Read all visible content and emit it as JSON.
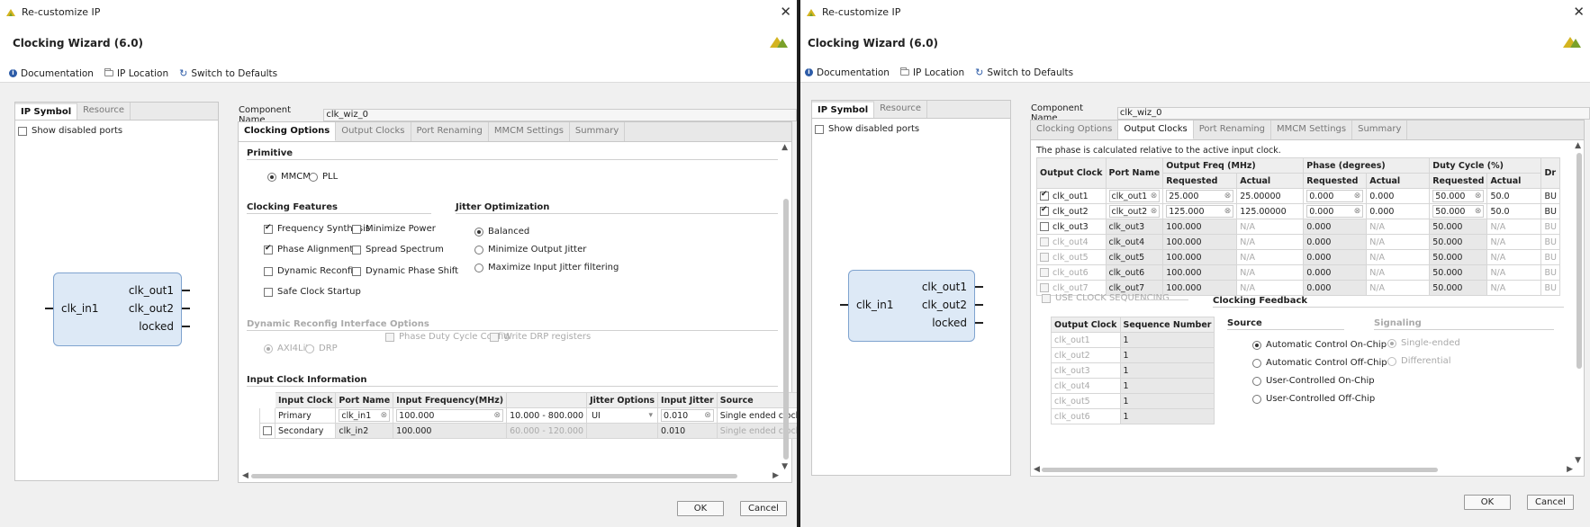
{
  "left": {
    "title_bar": "Re-customize IP",
    "wizard_title": "Clocking Wizard (6.0)",
    "links": {
      "documentation": "Documentation",
      "ip_location": "IP Location",
      "defaults": "Switch to Defaults"
    },
    "left_tabs": [
      "IP Symbol",
      "Resource"
    ],
    "show_disabled": "Show disabled ports",
    "symbol": {
      "in": "clk_in1",
      "outs": [
        "clk_out1",
        "clk_out2",
        "locked"
      ]
    },
    "component_label": "Component Name",
    "component_value": "clk_wiz_0",
    "tabs": [
      "Clocking Options",
      "Output Clocks",
      "Port Renaming",
      "MMCM Settings",
      "Summary"
    ],
    "primitive": {
      "title": "Primitive",
      "options": [
        "MMCM",
        "PLL"
      ],
      "selected": "MMCM"
    },
    "features": {
      "title": "Clocking Features",
      "items": [
        {
          "label": "Frequency Synthesis",
          "checked": true
        },
        {
          "label": "Minimize Power",
          "checked": false
        },
        {
          "label": "Phase Alignment",
          "checked": true
        },
        {
          "label": "Spread Spectrum",
          "checked": false
        },
        {
          "label": "Dynamic Reconfig",
          "checked": false
        },
        {
          "label": "Dynamic Phase Shift",
          "checked": false
        },
        {
          "label": "Safe Clock Startup",
          "checked": false
        }
      ]
    },
    "jitter": {
      "title": "Jitter Optimization",
      "options": [
        "Balanced",
        "Minimize Output Jitter",
        "Maximize Input Jitter filtering"
      ],
      "selected": "Balanced"
    },
    "dyn": {
      "title": "Dynamic Reconfig Interface Options",
      "radios": [
        "AXI4Lite",
        "DRP"
      ],
      "checks": [
        "Phase Duty Cycle Config",
        "Write DRP registers"
      ]
    },
    "input_info": {
      "title": "Input Clock Information",
      "headers": [
        "Input Clock",
        "Port Name",
        "Input Frequency(MHz)",
        "",
        "Jitter Options",
        "Input Jitter",
        "Source"
      ],
      "rows": [
        {
          "clock": "Primary",
          "port": "clk_in1",
          "freq": "100.000",
          "range": "10.000 - 800.000",
          "jitter_opt": "UI",
          "jitter": "0.010",
          "source": "Single ended clock capable p"
        },
        {
          "clock": "Secondary",
          "port": "clk_in2",
          "freq": "100.000",
          "range": "60.000 - 120.000",
          "jitter_opt": "",
          "jitter": "0.010",
          "source": "Single ended clock capable p"
        }
      ]
    },
    "ok": "OK",
    "cancel": "Cancel"
  },
  "right": {
    "title_bar": "Re-customize IP",
    "wizard_title": "Clocking Wizard (6.0)",
    "links": {
      "documentation": "Documentation",
      "ip_location": "IP Location",
      "defaults": "Switch to Defaults"
    },
    "left_tabs": [
      "IP Symbol",
      "Resource"
    ],
    "show_disabled": "Show disabled ports",
    "symbol": {
      "in": "clk_in1",
      "outs": [
        "clk_out1",
        "clk_out2",
        "locked"
      ]
    },
    "component_label": "Component Name",
    "component_value": "clk_wiz_0",
    "tabs": [
      "Clocking Options",
      "Output Clocks",
      "Port Renaming",
      "MMCM Settings",
      "Summary"
    ],
    "phase_note": "The phase is calculated relative to the active input clock.",
    "out_table": {
      "h1": [
        "Output Clock",
        "Port Name",
        "Output Freq (MHz)",
        "Phase (degrees)",
        "Duty Cycle (%)",
        "Dr"
      ],
      "h2": [
        "Requested",
        "Actual",
        "Requested",
        "Actual",
        "Requested",
        "Actual"
      ],
      "rows": [
        {
          "clk": "clk_out1",
          "port": "clk_out1",
          "freq_req": "25.000",
          "freq_act": "25.00000",
          "ph_req": "0.000",
          "ph_act": "0.000",
          "dc_req": "50.000",
          "dc_act": "50.0",
          "dr": "BU",
          "checked": true,
          "enabled": true
        },
        {
          "clk": "clk_out2",
          "port": "clk_out2",
          "freq_req": "125.000",
          "freq_act": "125.00000",
          "ph_req": "0.000",
          "ph_act": "0.000",
          "dc_req": "50.000",
          "dc_act": "50.0",
          "dr": "BU",
          "checked": true,
          "enabled": true
        },
        {
          "clk": "clk_out3",
          "port": "clk_out3",
          "freq_req": "100.000",
          "freq_act": "N/A",
          "ph_req": "0.000",
          "ph_act": "N/A",
          "dc_req": "50.000",
          "dc_act": "N/A",
          "dr": "BU",
          "checked": false,
          "enabled": true
        },
        {
          "clk": "clk_out4",
          "port": "clk_out4",
          "freq_req": "100.000",
          "freq_act": "N/A",
          "ph_req": "0.000",
          "ph_act": "N/A",
          "dc_req": "50.000",
          "dc_act": "N/A",
          "dr": "BU",
          "checked": false,
          "enabled": false
        },
        {
          "clk": "clk_out5",
          "port": "clk_out5",
          "freq_req": "100.000",
          "freq_act": "N/A",
          "ph_req": "0.000",
          "ph_act": "N/A",
          "dc_req": "50.000",
          "dc_act": "N/A",
          "dr": "BU",
          "checked": false,
          "enabled": false
        },
        {
          "clk": "clk_out6",
          "port": "clk_out6",
          "freq_req": "100.000",
          "freq_act": "N/A",
          "ph_req": "0.000",
          "ph_act": "N/A",
          "dc_req": "50.000",
          "dc_act": "N/A",
          "dr": "BU",
          "checked": false,
          "enabled": false
        },
        {
          "clk": "clk_out7",
          "port": "clk_out7",
          "freq_req": "100.000",
          "freq_act": "N/A",
          "ph_req": "0.000",
          "ph_act": "N/A",
          "dc_req": "50.000",
          "dc_act": "N/A",
          "dr": "BU",
          "checked": false,
          "enabled": false
        }
      ]
    },
    "use_seq": "USE CLOCK SEQUENCING",
    "seq_table": {
      "headers": [
        "Output Clock",
        "Sequence Number"
      ],
      "rows": [
        [
          "clk_out1",
          "1"
        ],
        [
          "clk_out2",
          "1"
        ],
        [
          "clk_out3",
          "1"
        ],
        [
          "clk_out4",
          "1"
        ],
        [
          "clk_out5",
          "1"
        ],
        [
          "clk_out6",
          "1"
        ]
      ]
    },
    "feedback": {
      "title": "Clocking Feedback",
      "source_title": "Source",
      "sources": [
        "Automatic Control On-Chip",
        "Automatic Control Off-Chip",
        "User-Controlled On-Chip",
        "User-Controlled Off-Chip"
      ],
      "selected": "Automatic Control On-Chip",
      "signaling_title": "Signaling",
      "signaling": [
        "Single-ended",
        "Differential"
      ]
    },
    "ok": "OK",
    "cancel": "Cancel"
  }
}
